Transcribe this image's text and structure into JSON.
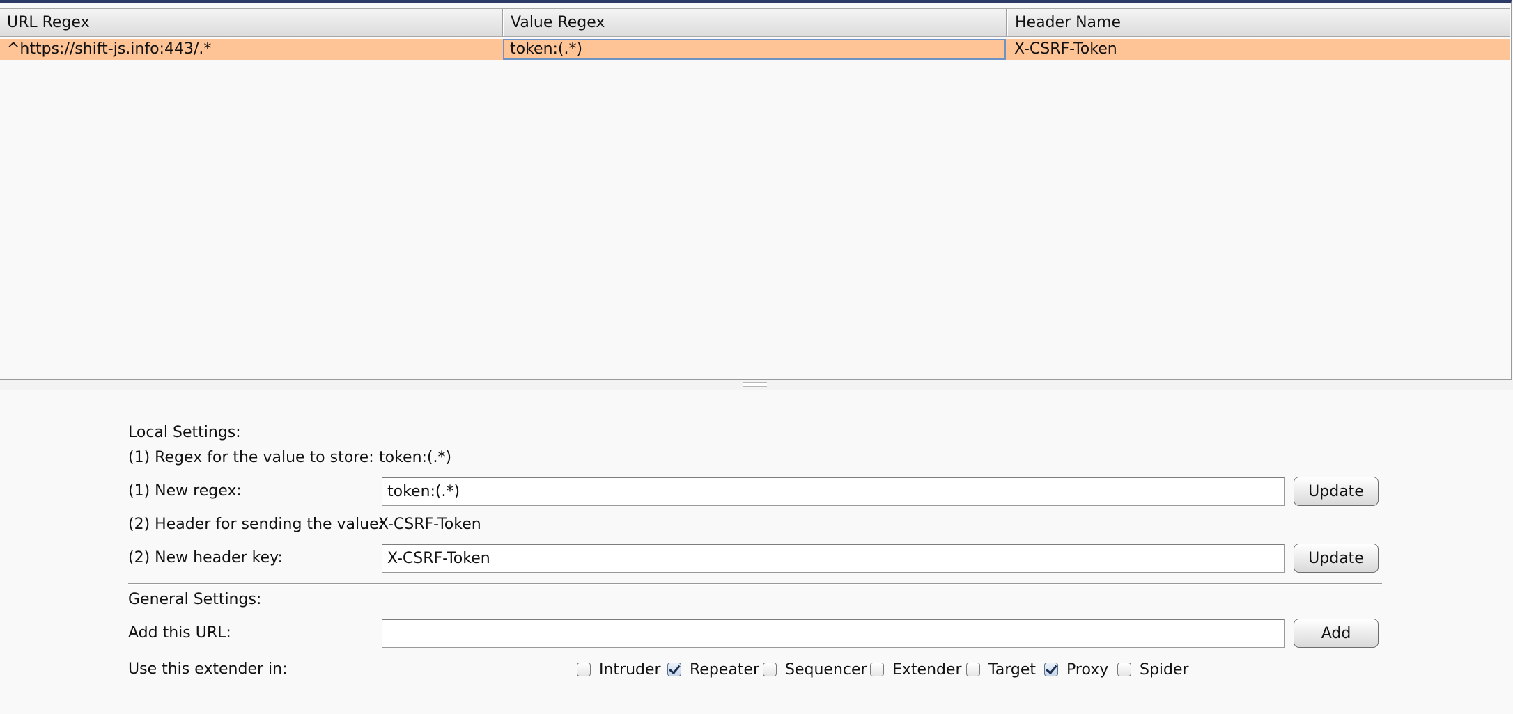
{
  "table": {
    "columns": [
      "URL Regex",
      "Value Regex",
      "Header Name"
    ],
    "rows": [
      {
        "url_regex": "^https://shift-js.info:443/.*",
        "value_regex": "token:(.*)",
        "header_name": "X-CSRF-Token"
      }
    ]
  },
  "local_settings": {
    "title": "Local Settings:",
    "regex_label": "(1) Regex for the value to store:",
    "regex_value": "token:(.*)",
    "new_regex_label": "(1) New regex:",
    "new_regex_input": "token:(.*)",
    "header_label": "(2) Header for sending the value:",
    "header_value": "X-CSRF-Token",
    "new_header_label": "(2) New header key:",
    "new_header_input": "X-CSRF-Token",
    "update_label": "Update"
  },
  "general_settings": {
    "title": "General Settings:",
    "add_url_label": "Add this URL:",
    "add_url_input": "",
    "add_label": "Add",
    "use_in_label": "Use this extender in:",
    "tools": [
      {
        "name": "Intruder",
        "checked": false
      },
      {
        "name": "Repeater",
        "checked": true
      },
      {
        "name": "Sequencer",
        "checked": false
      },
      {
        "name": "Extender",
        "checked": false
      },
      {
        "name": "Target",
        "checked": false
      },
      {
        "name": "Proxy",
        "checked": true
      },
      {
        "name": "Spider",
        "checked": false
      }
    ]
  },
  "colors": {
    "selected_row": "#ffc496",
    "focus_border": "#6f93c4",
    "top_border": "#2b3a66"
  }
}
